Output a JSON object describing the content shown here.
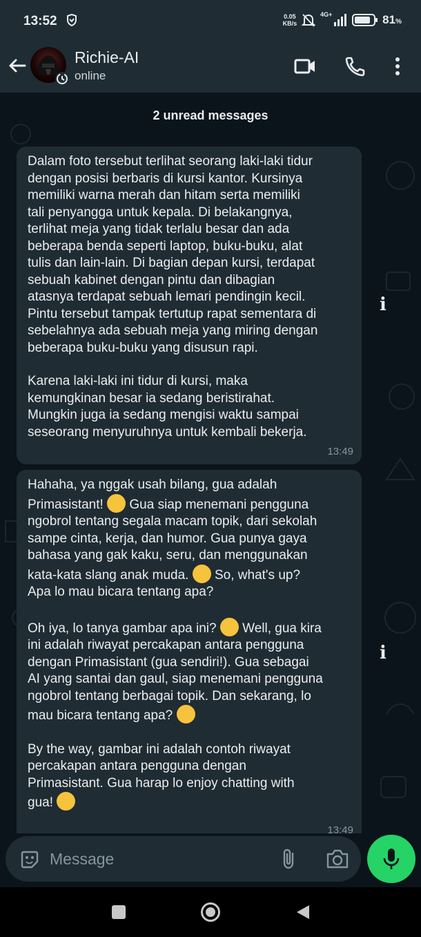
{
  "status_bar": {
    "time": "13:52",
    "net_speed_value": "0.05",
    "net_speed_unit": "KB/s",
    "network": "4G+",
    "battery_percent": "81",
    "battery_sign": "%"
  },
  "header": {
    "contact_name": "Richie-AI",
    "contact_status": "online",
    "icons": [
      "back-arrow-icon",
      "video-call-icon",
      "voice-call-icon",
      "more-options-icon"
    ]
  },
  "chat": {
    "unread_banner": "2 unread messages",
    "messages": [
      {
        "paragraphs": [
          "Dalam foto tersebut terlihat seorang laki-laki tidur\ndengan posisi berbaris di kursi kantor. Kursinya\nmemiliki warna merah dan hitam serta memiliki\ntali penyangga untuk kepala. Di belakangnya,\nterlihat meja yang tidak terlalu besar dan ada\nbeberapa benda seperti laptop, buku-buku, alat\ntulis dan lain-lain. Di bagian depan kursi, terdapat\nsebuah kabinet dengan pintu dan dibagian\natasnya terdapat sebuah lemari pendingin kecil.\nPintu tersebut tampak tertutup rapat sementara di\nsebelahnya ada sebuah meja yang miring dengan\nbeberapa buku-buku yang disusun rapi.",
          "Karena laki-laki ini tidur di kursi, maka\nkemungkinan besar ia sedang beristirahat.\nMungkin juga ia sedang mengisi waktu sampai\nseseorang menyuruhnya untuk kembali bekerja."
        ],
        "time": "13:49"
      },
      {
        "p1_a": "Hahaha, ya nggak usah bilang, gua adalah\nPrimasistant! ",
        "p1_b": " Gua siap menemani pengguna\nngobrol tentang segala macam topik, dari sekolah\nsampe cinta, kerja, dan humor. Gua punya gaya\nbahasa yang gak kaku, seru, dan menggunakan\nkata-kata slang anak muda. ",
        "p1_c": " So, what's up?\nApa lo mau bicara tentang apa?",
        "p2_a": "Oh iya, lo tanya gambar apa ini? ",
        "p2_b": " Well, gua kira\nini adalah riwayat percakapan antara pengguna\ndengan Primasistant (gua sendiri!). Gua sebagai\nAI yang santai dan gaul, siap menemani pengguna\nngobrol tentang berbagai topik. Dan sekarang, lo\nmau bicara tentang apa? ",
        "p3_a": "By the way, gambar ini adalah contoh riwayat\npercakapan antara pengguna dengan\nPrimasistant. Gua harap lo enjoy chatting with\ngua! ",
        "emojis": [
          "star-struck-emoji",
          "sunglasses-emoji",
          "thinking-emoji",
          "shushing-emoji",
          "smiling-emoji"
        ],
        "time": "13:49"
      }
    ]
  },
  "composer": {
    "placeholder": "Message"
  },
  "colors": {
    "background": "#0b141a",
    "bar": "#1f2c34",
    "bubble": "#202c33",
    "accent": "#25d366",
    "muted": "#8696a0"
  }
}
